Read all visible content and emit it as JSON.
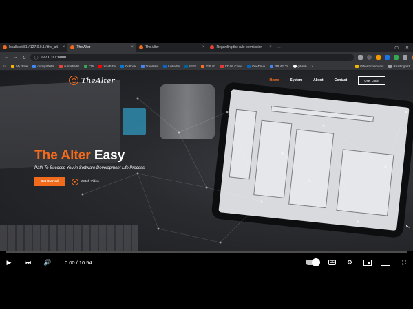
{
  "browser": {
    "tabs": [
      {
        "label": "localhost:81 / 127.0.0.1 / the_alt",
        "color": "#f26b1d",
        "active": false
      },
      {
        "label": "The Alter",
        "color": "#f26b1d",
        "active": true
      },
      {
        "label": "The Alter",
        "color": "#f26b1d",
        "active": false
      },
      {
        "label": "Regarding the rule permission -",
        "color": "#ea4335",
        "active": false
      }
    ],
    "new_tab": "+",
    "url": "127.0.0.1:8000",
    "bookmarks": [
      {
        "label": "My drive",
        "color": "#f4b400"
      },
      {
        "label": "dumiya0098",
        "color": "#4285f4"
      },
      {
        "label": "dumisha98",
        "color": "#ea4335"
      },
      {
        "label": "CW",
        "color": "#34a853"
      },
      {
        "label": "YouTube",
        "color": "#ff0000"
      },
      {
        "label": "Outlook",
        "color": "#0078d4"
      },
      {
        "label": "Translate",
        "color": "#4285f4"
      },
      {
        "label": "LinkedIn",
        "color": "#0a66c2"
      },
      {
        "label": "IEEE",
        "color": "#00629b"
      },
      {
        "label": "GitLab",
        "color": "#fc6d26"
      },
      {
        "label": "CDAP Cloud",
        "color": "#e53935"
      },
      {
        "label": "OneDrive",
        "color": "#0364b8"
      },
      {
        "label": "RP 4th Yr",
        "color": "#4285f4"
      },
      {
        "label": "gitHub",
        "color": "#ffffff"
      }
    ],
    "bookmarks_right": [
      "Other bookmarks",
      "Reading list"
    ]
  },
  "site": {
    "logo": "TheAlter",
    "nav": [
      "Home",
      "System",
      "About",
      "Contact"
    ],
    "active_nav": "Home",
    "login": "User Login",
    "hero": {
      "title_orange": "The Alter",
      "title_white": "Easy",
      "subtitle": "Path To Success You in Software Development Life Process.",
      "cta": "Get Started",
      "watch": "Watch Video"
    }
  },
  "player": {
    "time": "0:00 / 10:54",
    "progress": 0,
    "cc": "CC"
  }
}
